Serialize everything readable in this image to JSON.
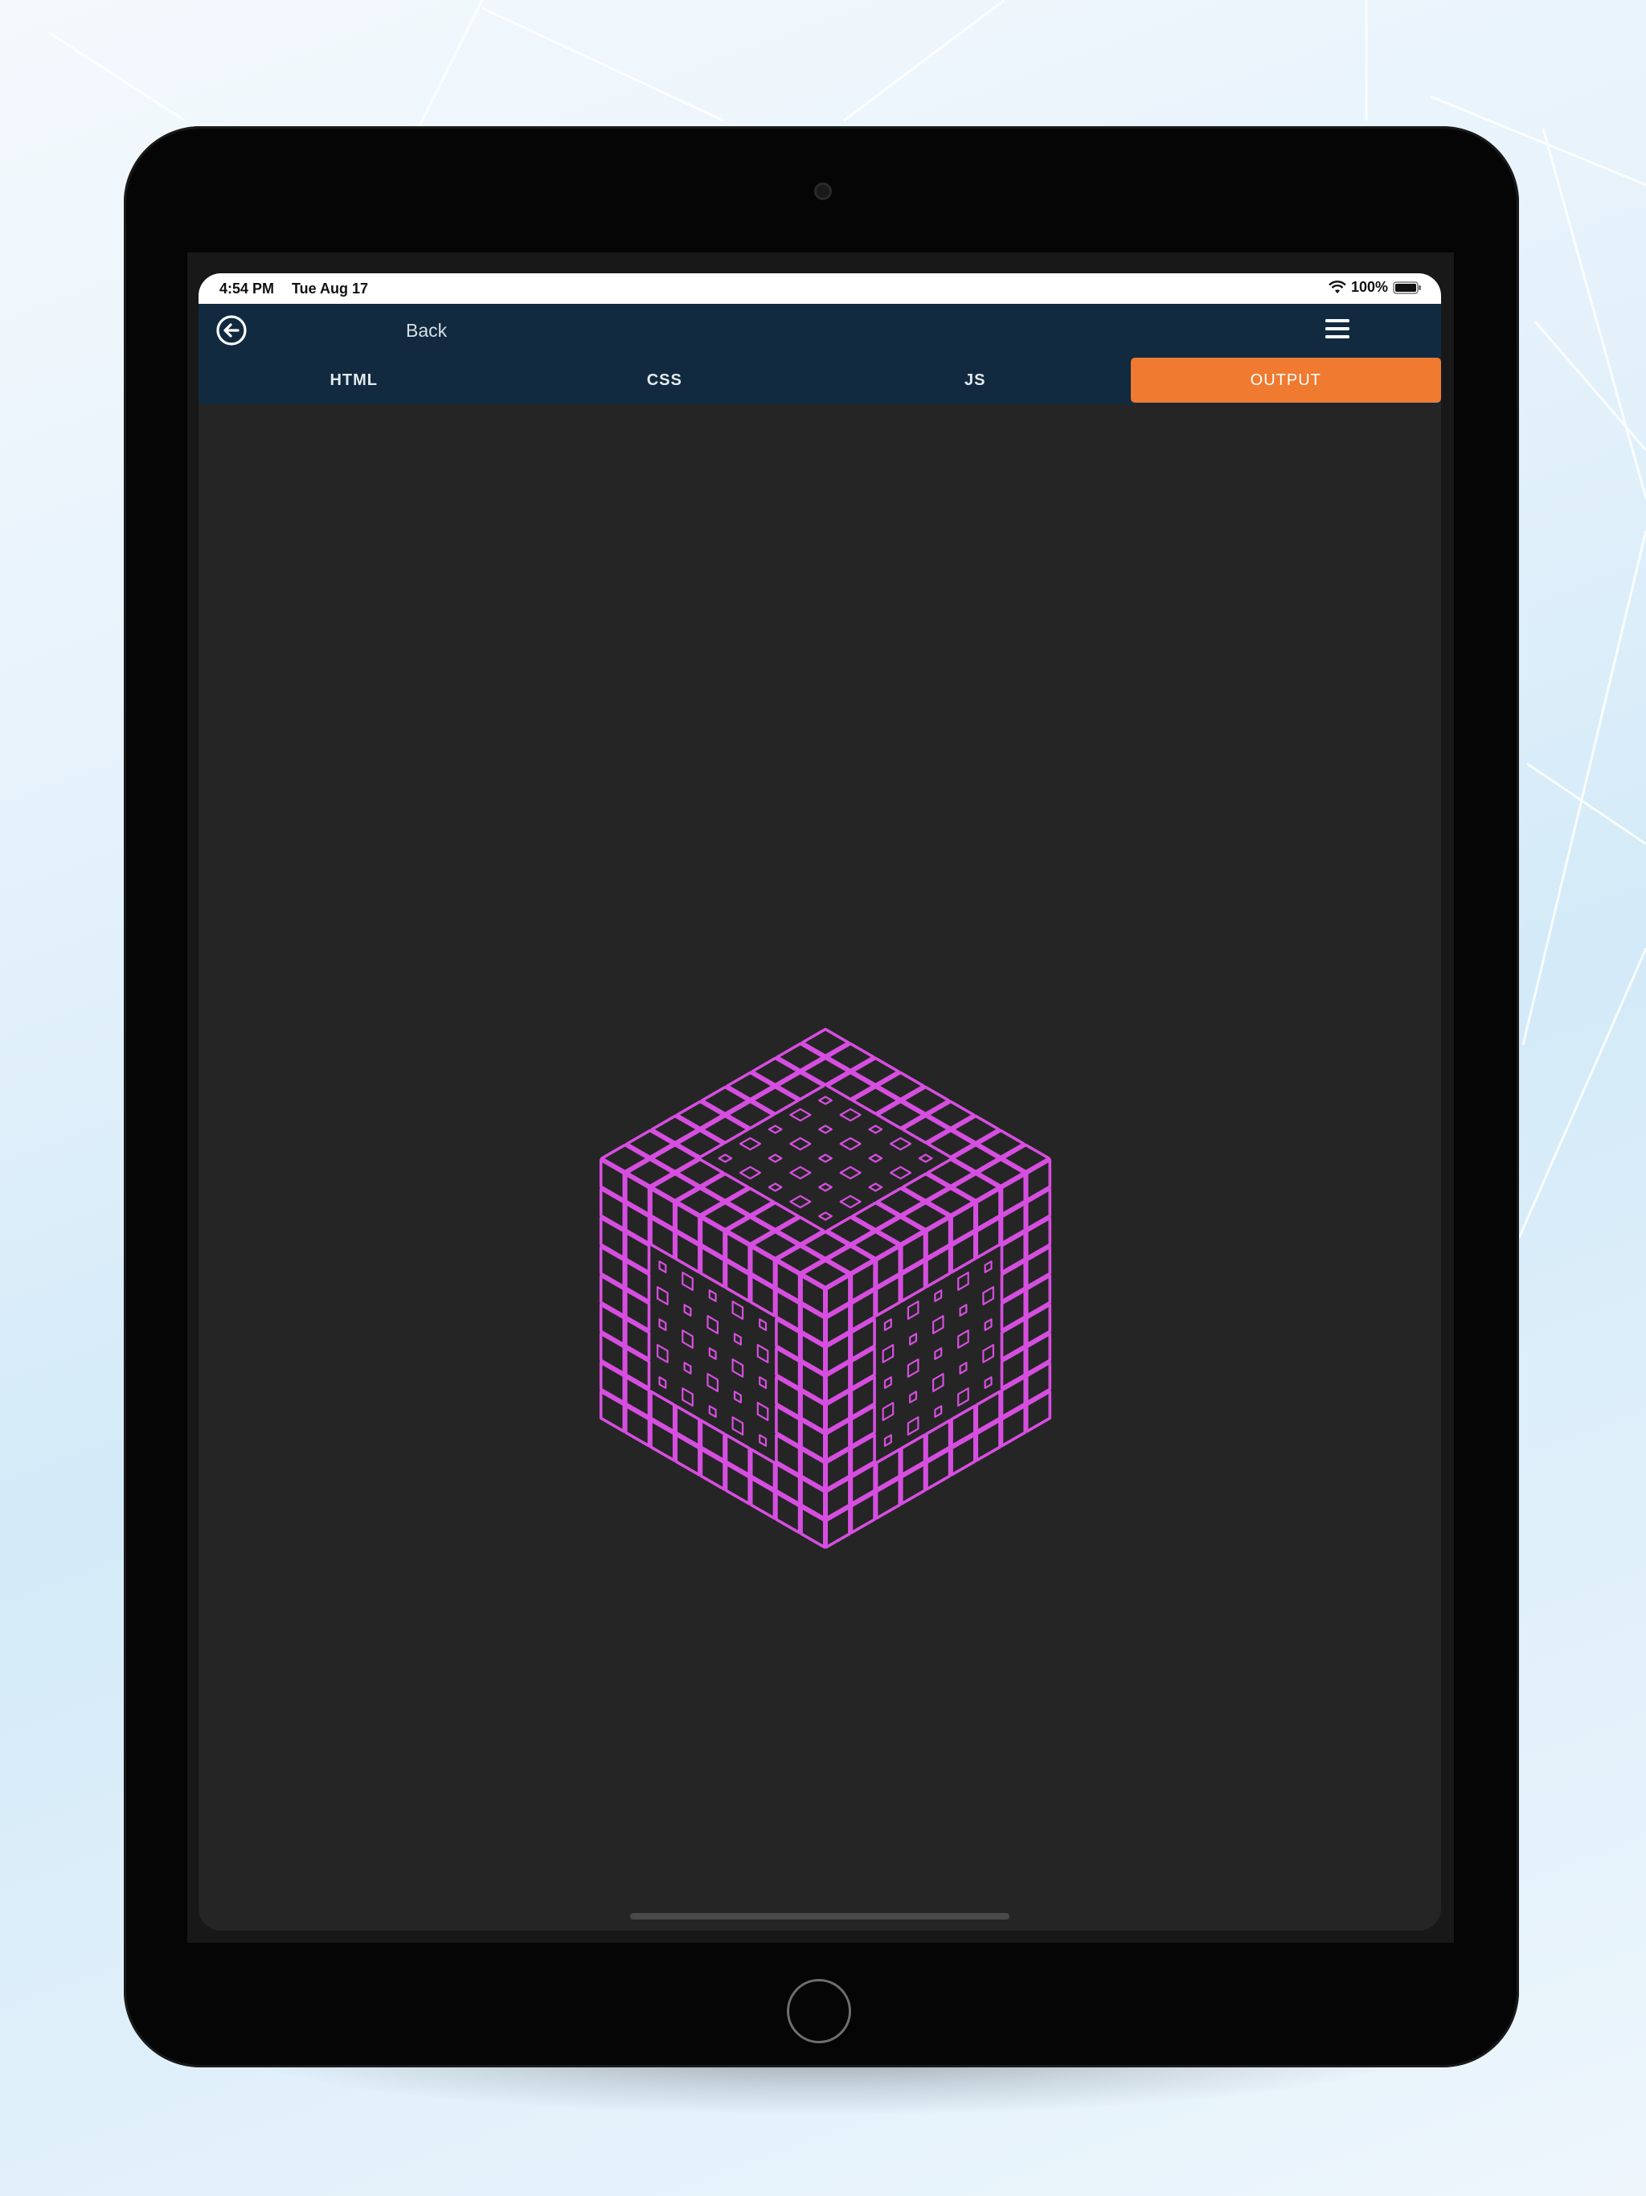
{
  "status_bar": {
    "time": "4:54 PM",
    "date": "Tue Aug 17",
    "battery": "100%",
    "icons": [
      "wifi-icon",
      "battery-icon"
    ]
  },
  "navbar": {
    "back_label": "Back",
    "back_icon": "circle-arrow-left-icon",
    "menu_icon": "hamburger-menu-icon"
  },
  "tabs": [
    {
      "label": "HTML",
      "active": false
    },
    {
      "label": "CSS",
      "active": false
    },
    {
      "label": "JS",
      "active": false
    },
    {
      "label": "OUTPUT",
      "active": true
    }
  ],
  "colors": {
    "navbar_bg": "#112a3f",
    "tab_active": "#f07a30",
    "output_bg": "#252525",
    "cube_stroke": "#d64ee0"
  }
}
